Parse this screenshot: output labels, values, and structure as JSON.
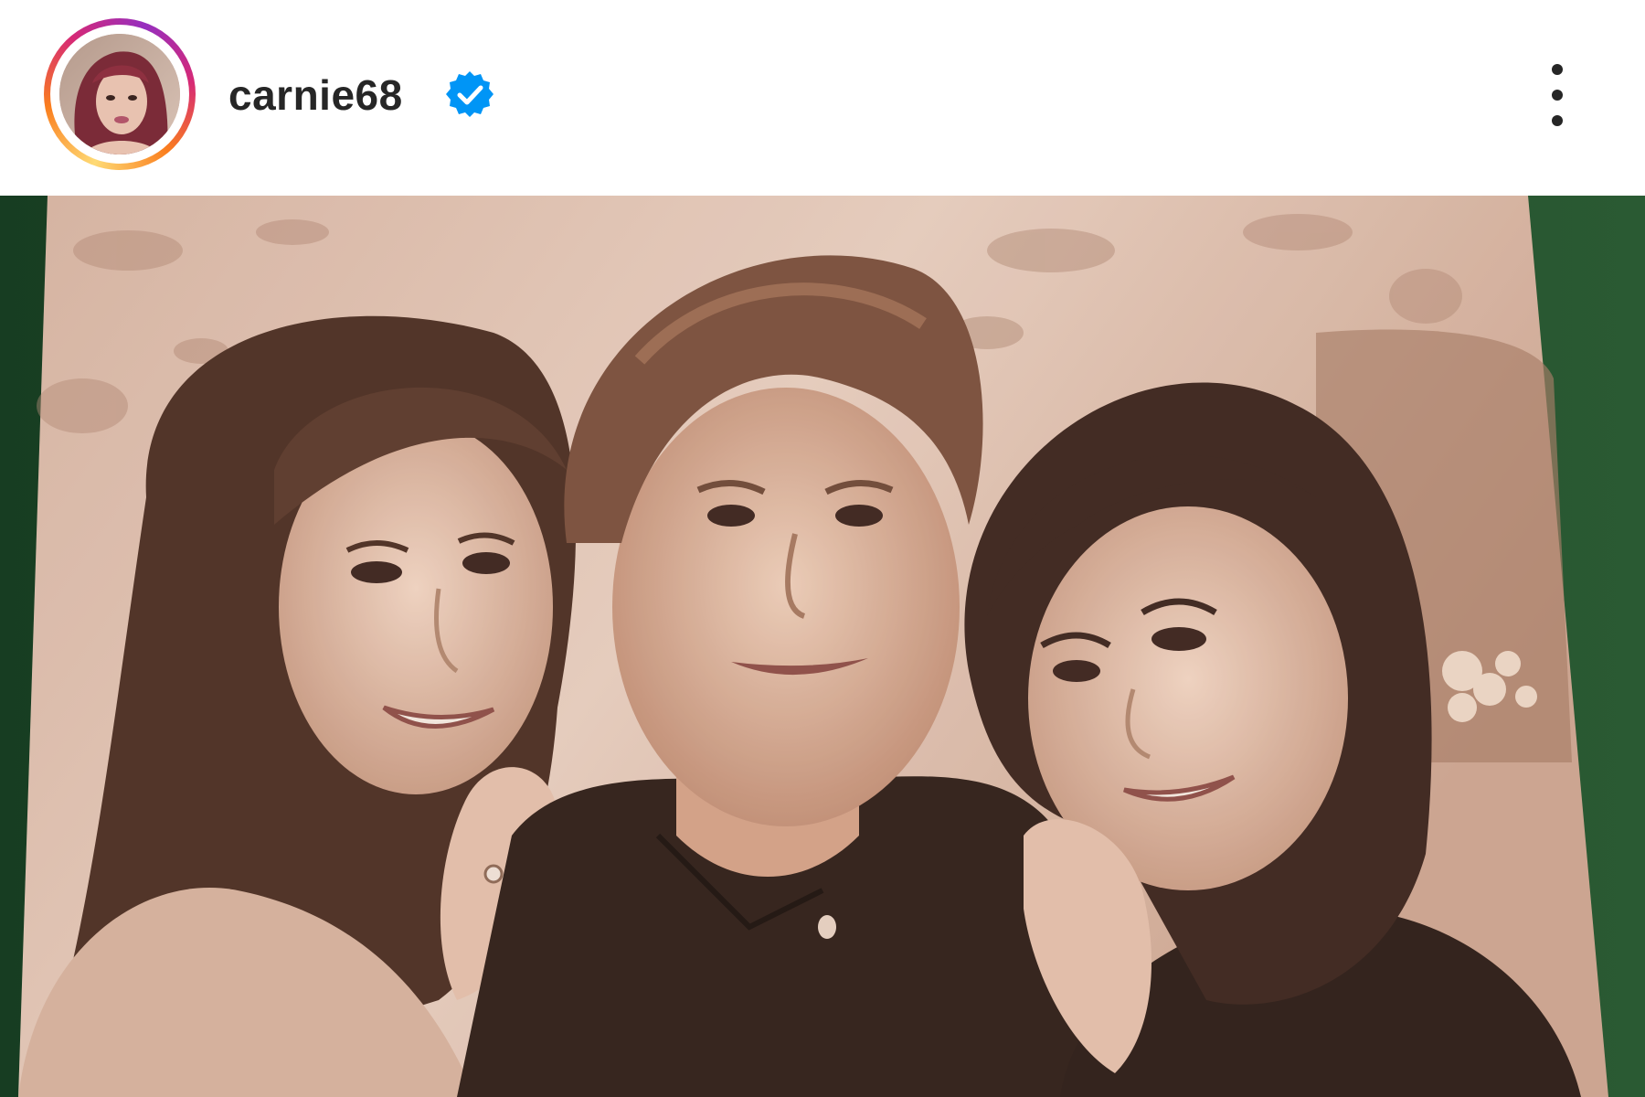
{
  "header": {
    "username": "carnie68",
    "verified": true,
    "avatar_icon": "profile-photo-icon",
    "menu_icon": "more-vertical-icon"
  },
  "post": {
    "media_type": "photo",
    "media_description_icon": "sepia-photograph"
  },
  "colors": {
    "text": "#262626",
    "verified_badge": "#0095f6",
    "background": "#ffffff",
    "frame_green": "#1f4a2a"
  }
}
